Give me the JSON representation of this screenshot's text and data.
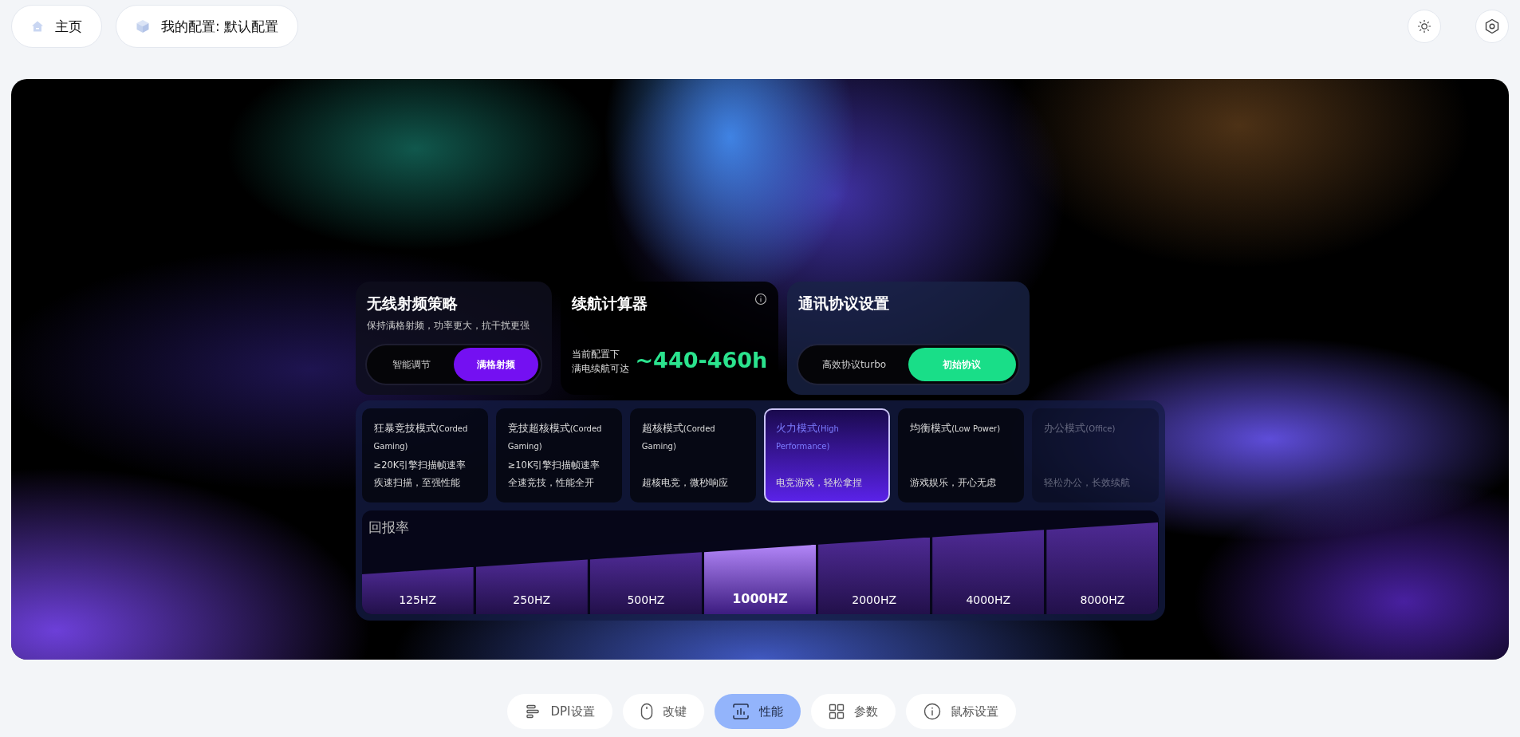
{
  "top_bar": {
    "home": "主页",
    "profile": "我的配置: 默认配置"
  },
  "wireless_rf": {
    "title": "无线射频策略",
    "description": "保持满格射频，功率更大，抗干扰更强",
    "options": [
      {
        "label": "智能调节",
        "selected": false
      },
      {
        "label": "满格射频",
        "selected": true
      }
    ]
  },
  "battery_calculator": {
    "title": "续航计算器",
    "caption_lines": [
      "当前配置下",
      "满电续航可达"
    ],
    "estimate": "~440-460h"
  },
  "protocol": {
    "title": "通讯协议设置",
    "options": [
      {
        "label": "高效协议turbo",
        "selected": false
      },
      {
        "label": "初始协议",
        "selected": true
      }
    ]
  },
  "modes": [
    {
      "name": "狂暴竞技模式",
      "subtitle": "(Corded Gaming)",
      "lines": [
        "≥20K引擎扫描帧速率",
        "疾速扫描，至强性能"
      ],
      "selected": false,
      "disabled": false
    },
    {
      "name": "竞技超核模式",
      "subtitle": "(Corded Gaming)",
      "lines": [
        "≥10K引擎扫描帧速率",
        "全速竞技，性能全开"
      ],
      "selected": false,
      "disabled": false
    },
    {
      "name": "超核模式",
      "subtitle": "(Corded Gaming)",
      "lines": [
        "超核电竞，微秒响应"
      ],
      "selected": false,
      "disabled": false
    },
    {
      "name": "火力模式",
      "subtitle": "(High Performance)",
      "lines": [
        "电竞游戏，轻松拿捏"
      ],
      "selected": true,
      "disabled": false
    },
    {
      "name": "均衡模式",
      "subtitle": "(Low Power)",
      "lines": [
        "游戏娱乐，开心无虑"
      ],
      "selected": false,
      "disabled": false
    },
    {
      "name": "办公模式",
      "subtitle": "(Office)",
      "lines": [
        "轻松办公，长效续航"
      ],
      "selected": false,
      "disabled": true
    }
  ],
  "polling_rate": {
    "title": "回报率",
    "rates": [
      {
        "label": "125HZ",
        "selected": false
      },
      {
        "label": "250HZ",
        "selected": false
      },
      {
        "label": "500HZ",
        "selected": false
      },
      {
        "label": "1000HZ",
        "selected": true
      },
      {
        "label": "2000HZ",
        "selected": false
      },
      {
        "label": "4000HZ",
        "selected": false
      },
      {
        "label": "8000HZ",
        "selected": false
      }
    ]
  },
  "nav": [
    {
      "label": "DPI设置",
      "selected": false
    },
    {
      "label": "改键",
      "selected": false
    },
    {
      "label": "性能",
      "selected": true
    },
    {
      "label": "参数",
      "selected": false
    },
    {
      "label": "鼠标设置",
      "selected": false
    }
  ]
}
